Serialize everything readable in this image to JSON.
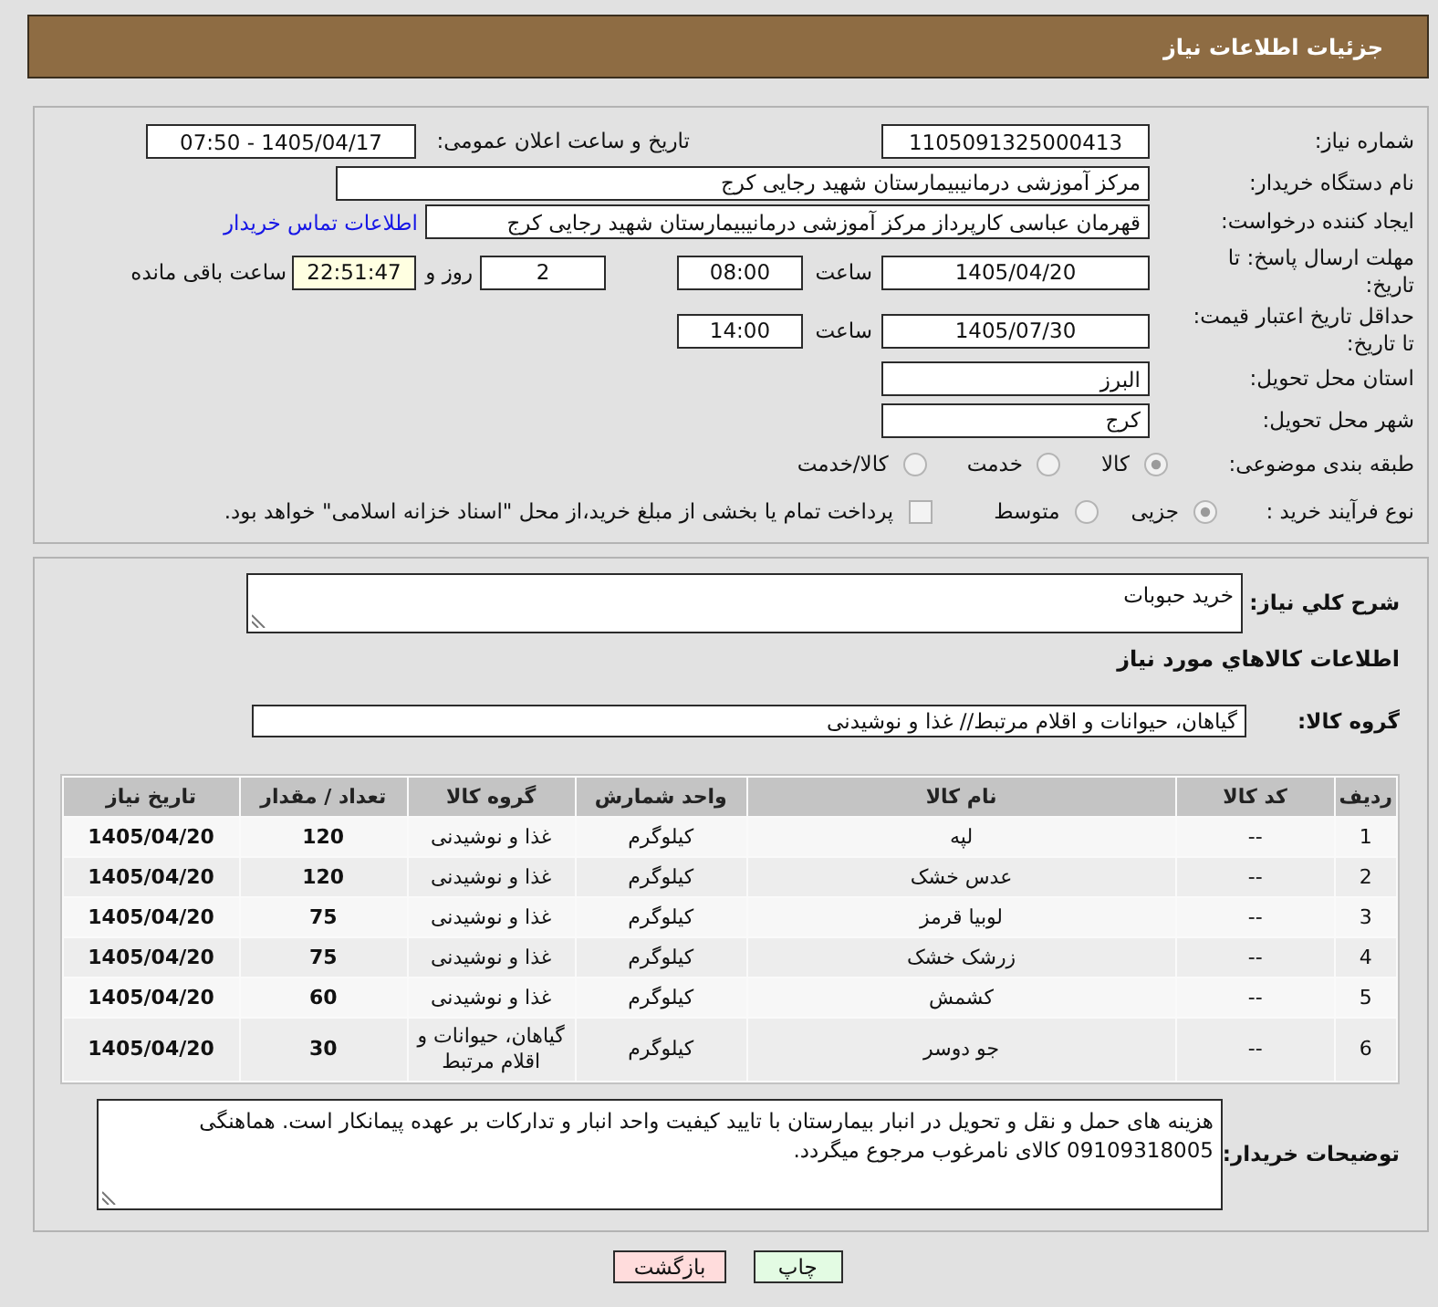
{
  "header": {
    "title": "جزئیات اطلاعات نیاز"
  },
  "details": {
    "need_number": {
      "label": "شماره نیاز:",
      "value": "1105091325000413"
    },
    "announced": {
      "label": "تاریخ و ساعت اعلان عمومی:",
      "value": "1405/04/17 - 07:50"
    },
    "buyer": {
      "label": "نام دستگاه خریدار:",
      "value": "مرکز آموزشی درمانیبیمارستان شهید رجایی کرج"
    },
    "creator": {
      "label": "ایجاد کننده درخواست:",
      "value": "قهرمان عباسی کارپرداز مرکز آموزشی درمانیبیمارستان شهید رجایی کرج",
      "contact_link": "اطلاعات تماس خریدار"
    },
    "reply_deadline": {
      "label": "مهلت ارسال پاسخ: تا تاریخ:",
      "date": "1405/04/20",
      "time_label": "ساعت",
      "time": "08:00",
      "days": "2",
      "days_label": "روز و",
      "remaining_time": "22:51:47",
      "remaining_label": "ساعت باقی مانده"
    },
    "price_validity": {
      "label": "حداقل تاریخ اعتبار قیمت: تا تاریخ:",
      "date": "1405/07/30",
      "time_label": "ساعت",
      "time": "14:00"
    },
    "province": {
      "label": "استان محل تحویل:",
      "value": "البرز"
    },
    "city": {
      "label": "شهر محل تحویل:",
      "value": "کرج"
    },
    "category": {
      "label": "طبقه بندی موضوعی:",
      "options": [
        {
          "label": "کالا",
          "selected": true
        },
        {
          "label": "خدمت",
          "selected": false
        },
        {
          "label": "کالا/خدمت",
          "selected": false
        }
      ]
    },
    "purchase_process": {
      "label": "نوع فرآیند خرید :",
      "options": [
        {
          "label": "جزیی",
          "selected": true
        },
        {
          "label": "متوسط",
          "selected": false
        }
      ],
      "treasury_payment": {
        "label": "پرداخت تمام یا بخشی از مبلغ خرید،از محل \"اسناد خزانه اسلامی\" خواهد بود.",
        "checked": false
      }
    }
  },
  "description": {
    "label": "شرح کلي نياز:",
    "value": "خرید حبوبات"
  },
  "goods": {
    "title": "اطلاعات کالاهاي مورد نياز",
    "group": {
      "label": "گروه کالا:",
      "value": "گیاهان، حیوانات و اقلام مرتبط// غذا و نوشیدنی"
    },
    "table": {
      "columns": [
        "ردیف",
        "کد کالا",
        "نام کالا",
        "واحد شمارش",
        "گروه کالا",
        "تعداد / مقدار",
        "تاریخ نیاز"
      ],
      "rows": [
        {
          "cells": [
            "1",
            "--",
            "لپه",
            "کیلوگرم",
            "غذا و نوشیدنی",
            "120",
            "1405/04/20"
          ]
        },
        {
          "cells": [
            "2",
            "--",
            "عدس خشک",
            "کیلوگرم",
            "غذا و نوشیدنی",
            "120",
            "1405/04/20"
          ]
        },
        {
          "cells": [
            "3",
            "--",
            "لوبیا قرمز",
            "کیلوگرم",
            "غذا و نوشیدنی",
            "75",
            "1405/04/20"
          ]
        },
        {
          "cells": [
            "4",
            "--",
            "زرشک خشک",
            "کیلوگرم",
            "غذا و نوشیدنی",
            "75",
            "1405/04/20"
          ]
        },
        {
          "cells": [
            "5",
            "--",
            "کشمش",
            "کیلوگرم",
            "غذا و نوشیدنی",
            "60",
            "1405/04/20"
          ]
        },
        {
          "cells": [
            "6",
            "--",
            "جو دوسر",
            "کیلوگرم",
            "گیاهان، حیوانات و اقلام مرتبط",
            "30",
            "1405/04/20"
          ]
        }
      ]
    }
  },
  "buyer_notes": {
    "label": "توضیحات خریدار:",
    "value": "هزینه های حمل و نقل و تحویل در انبار بیمارستان با تایید کیفیت واحد انبار و تدارکات بر عهده پیمانکار است. هماهنگی 09109318005  کالای نامرغوب مرجوع میگردد."
  },
  "buttons": [
    {
      "kind": "print",
      "label": "چاپ"
    },
    {
      "kind": "back",
      "label": "بازگشت"
    }
  ]
}
